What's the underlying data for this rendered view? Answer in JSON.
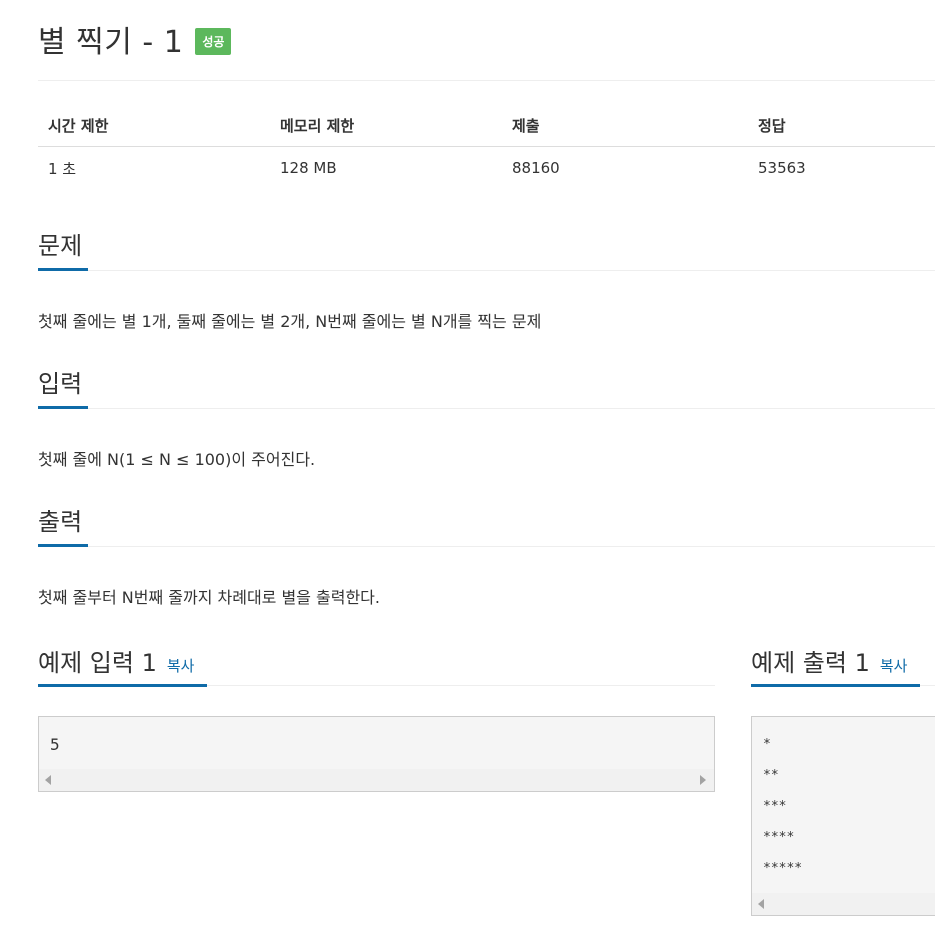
{
  "problem": {
    "title": "별 찍기 - 1",
    "status_badge": "성공"
  },
  "info_table": {
    "headers": [
      "시간 제한",
      "메모리 제한",
      "제출",
      "정답"
    ],
    "values": [
      "1 초",
      "128 MB",
      "88160",
      "53563"
    ]
  },
  "sections": {
    "description": {
      "heading": "문제",
      "text": "첫째 줄에는 별 1개, 둘째 줄에는 별 2개, N번째 줄에는 별 N개를 찍는 문제"
    },
    "input": {
      "heading": "입력",
      "text": "첫째 줄에 N(1 ≤ N ≤ 100)이 주어진다."
    },
    "output": {
      "heading": "출력",
      "text": "첫째 줄부터 N번째 줄까지 차례대로 별을 출력한다."
    }
  },
  "samples": {
    "input": {
      "heading": "예제 입력 1",
      "copy_label": "복사",
      "lines": [
        "5"
      ]
    },
    "output": {
      "heading": "예제 출력 1",
      "copy_label": "복사",
      "lines": [
        "*",
        "**",
        "***",
        "****",
        "*****"
      ]
    }
  },
  "colors": {
    "accent": "#0f6ba8",
    "success": "#5cb85c"
  }
}
